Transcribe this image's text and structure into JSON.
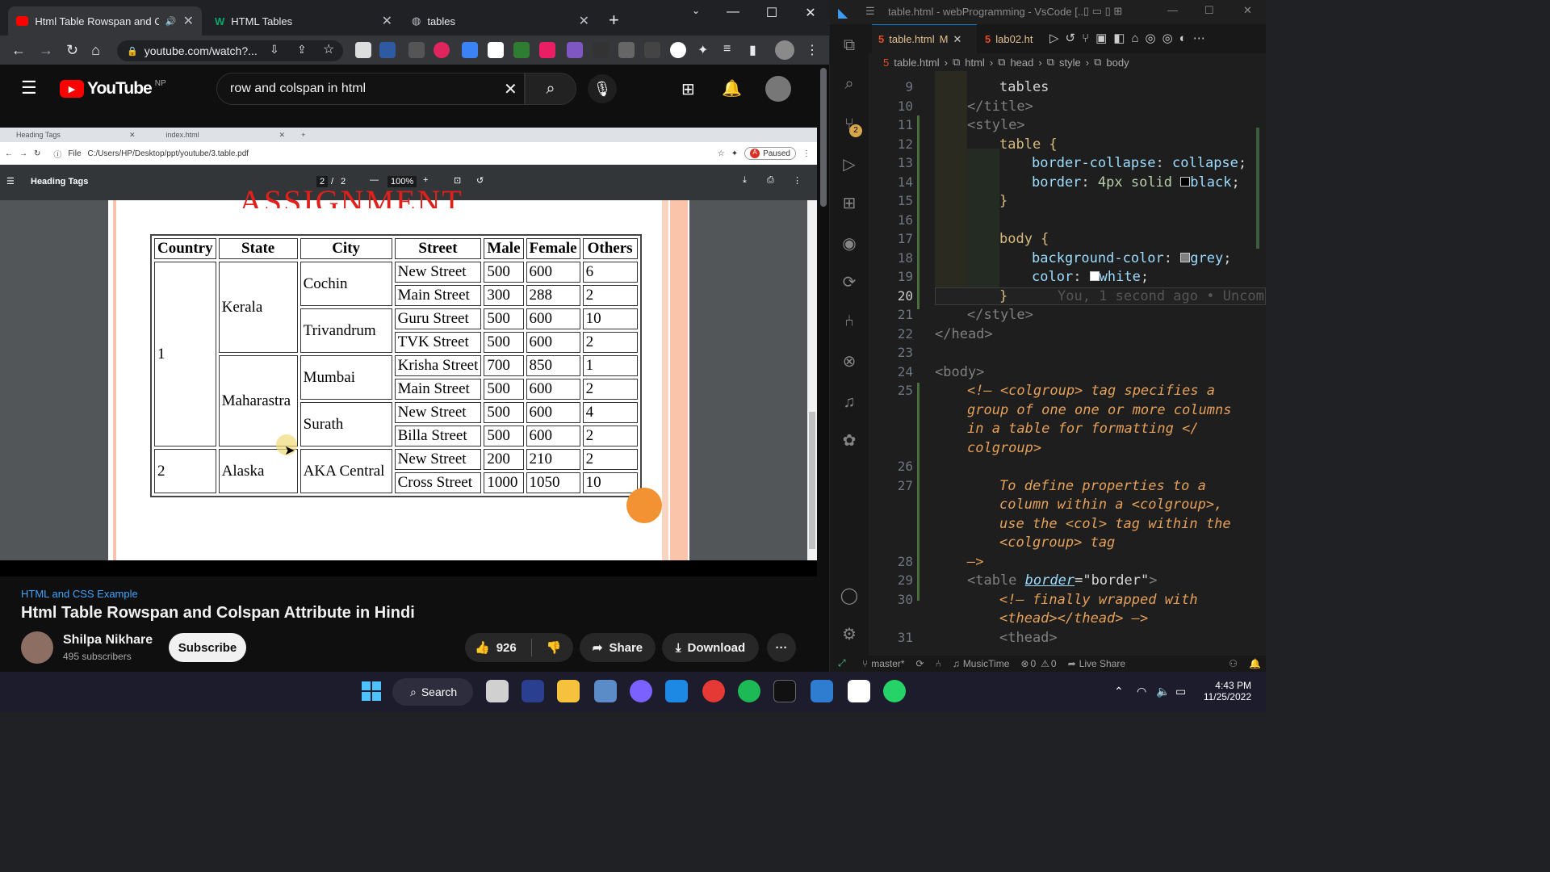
{
  "browser": {
    "tabs": [
      {
        "label": "Html Table Rowspan and Col",
        "active": true
      },
      {
        "label": "HTML Tables",
        "active": false
      },
      {
        "label": "tables",
        "active": false
      }
    ],
    "url": "youtube.com/watch?...",
    "window_controls": {
      "minimize": "—",
      "maximize": "☐",
      "close": "✕"
    }
  },
  "youtube": {
    "logo_text": "YouTube",
    "country": "NP",
    "search_value": "row and colspan in html"
  },
  "pdf_viewer": {
    "tabs": [
      "Heading Tags",
      "index.html"
    ],
    "file_label": "File",
    "path": "C:/Users/HP/Desktop/ppt/youtube/3.table.pdf",
    "profile_status": "Paused",
    "profile_initial": "A",
    "title": "Heading Tags",
    "page_current": "2",
    "page_total": "2",
    "zoom": "100%",
    "heading": "ASSIGNMENT"
  },
  "table": {
    "headers": [
      "Country",
      "State",
      "City",
      "Street",
      "Male",
      "Female",
      "Others"
    ],
    "countries": [
      "1",
      "2"
    ],
    "states": [
      "Kerala",
      "Maharastra",
      "Alaska"
    ],
    "cities": [
      "Cochin",
      "Trivandrum",
      "Mumbai",
      "Surath",
      "AKA Central"
    ],
    "rows": [
      {
        "street": "New Street",
        "male": "500",
        "female": "600",
        "others": "6"
      },
      {
        "street": "Main Street",
        "male": "300",
        "female": "288",
        "others": "2"
      },
      {
        "street": "Guru Street",
        "male": "500",
        "female": "600",
        "others": "10"
      },
      {
        "street": "TVK Street",
        "male": "500",
        "female": "600",
        "others": "2"
      },
      {
        "street": "Krisha Street",
        "male": "700",
        "female": "850",
        "others": "1"
      },
      {
        "street": "Main Street",
        "male": "500",
        "female": "600",
        "others": "2"
      },
      {
        "street": "New Street",
        "male": "500",
        "female": "600",
        "others": "4"
      },
      {
        "street": "Billa Street",
        "male": "500",
        "female": "600",
        "others": "2"
      },
      {
        "street": "New Street",
        "male": "200",
        "female": "210",
        "others": "2"
      },
      {
        "street": "Cross Street",
        "male": "1000",
        "female": "1050",
        "others": "10"
      }
    ]
  },
  "video": {
    "category": "HTML and CSS Example",
    "title": "Html Table Rowspan and Colspan Attribute in Hindi",
    "channel": "Shilpa Nikhare",
    "subscribers": "495 subscribers",
    "subscribe_label": "Subscribe",
    "likes": "926",
    "share_label": "Share",
    "download_label": "Download"
  },
  "vscode": {
    "window_title": "table.html - webProgramming - VsCode [...",
    "tabs": [
      {
        "label": "table.html",
        "badge": "M"
      },
      {
        "label": "lab02.ht",
        "badge": ""
      }
    ],
    "breadcrumbs": [
      "table.html",
      "html",
      "head",
      "style",
      "body"
    ],
    "scm_badge": "2",
    "status": {
      "branch": "master*",
      "music": "MusicTime",
      "problems": "0",
      "warnings": "0",
      "live_share": "Live Share"
    },
    "blame": "You, 1 second ago • Uncom",
    "lines": [
      "9",
      "10",
      "11",
      "12",
      "13",
      "14",
      "15",
      "16",
      "17",
      "18",
      "19",
      "20",
      "21",
      "22",
      "23",
      "24",
      "25",
      "26",
      "27",
      "28",
      "29",
      "30",
      "31"
    ],
    "code": {
      "l9": "tables",
      "l10_tag": "</title>",
      "l11_tag": "<style>",
      "l12_sel": "table {",
      "l13_prop": "border-collapse",
      "l13_val": "collapse",
      "l14_prop": "border",
      "l14_val": "4px solid",
      "l14_color": "black",
      "l15": "}",
      "l17_sel": "body {",
      "l18_prop": "background-color",
      "l18_color": "grey",
      "l19_prop": "color",
      "l19_color": "white",
      "l20": "}",
      "l21_tag": "</style>",
      "l22_tag": "</head>",
      "l24_tag": "<body>",
      "l25_a": "<!— <colgroup> tag specifies a",
      "l25_b": "group of one one or more columns",
      "l25_c": "in a table for formatting </",
      "l25_d": "colgroup>",
      "l27_a": "To define properties to a",
      "l27_b": "column within a <colgroup>,",
      "l27_c": "use the <col> tag within the",
      "l27_d": "<colgroup> tag",
      "l28": "—>",
      "l29_open": "<table ",
      "l29_attr": "border",
      "l29_eq": "=",
      "l29_val": "\"border\"",
      "l29_close": ">",
      "l30_a": "<!— finally wrapped with",
      "l30_b": "<thead></thead> —>",
      "l31_tag": "<thead>"
    }
  },
  "taskbar": {
    "search_label": "Search",
    "time": "4:43 PM",
    "date": "11/25/2022"
  }
}
